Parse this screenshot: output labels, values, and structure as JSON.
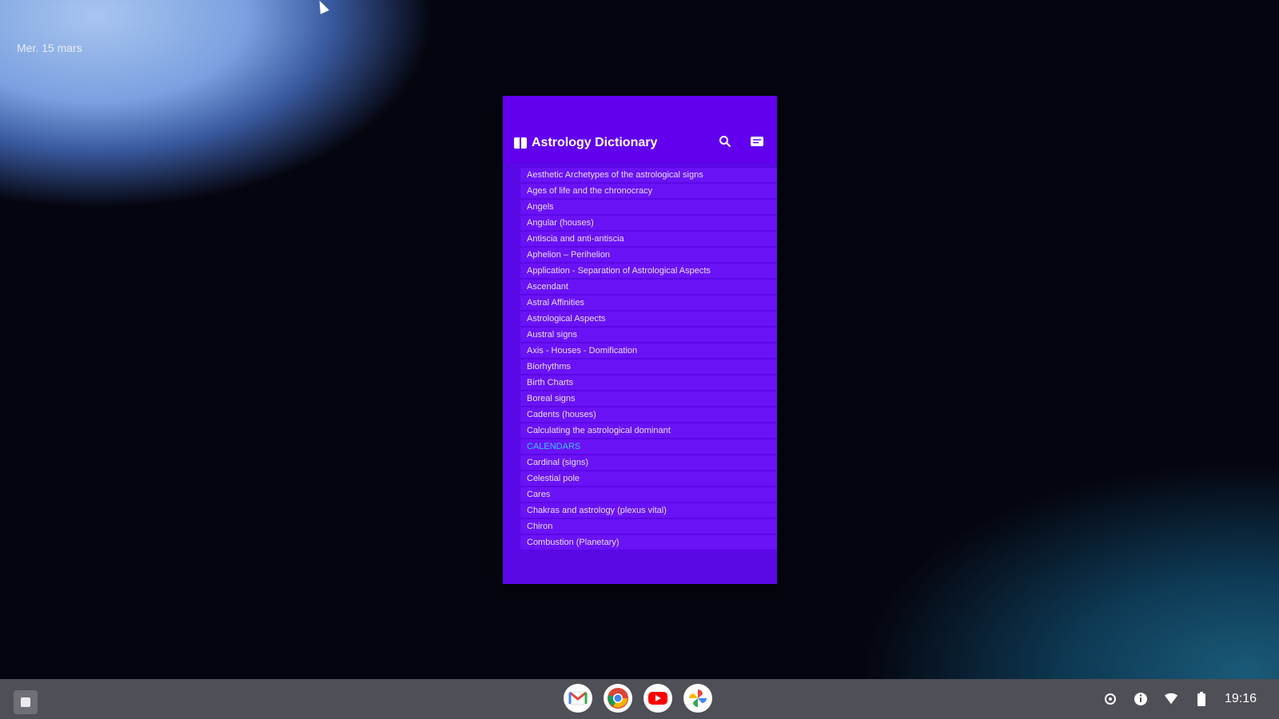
{
  "desktop": {
    "date_label": "Mer. 15 mars"
  },
  "app": {
    "title": "Astrology Dictionary",
    "icons": {
      "title_icon": "book-icon",
      "search": "search-icon",
      "message": "message-icon"
    },
    "colors": {
      "primary": "#6200ee",
      "list_bg": "#5a08e6",
      "item_bg": "#6a12f6",
      "special_item": "#38c8ff"
    },
    "list_items": [
      "Aesthetic Archetypes of the astrological signs",
      "Ages of life and the chronocracy",
      "Angels",
      "Angular (houses)",
      "Antiscia and anti-antiscia",
      "Aphelion – Perihelion",
      "Application - Separation of Astrological Aspects",
      "Ascendant",
      "Astral Affinities",
      "Astrological Aspects",
      "Austral signs",
      "Axis - Houses - Domification",
      "Biorhythms",
      "Birth Charts",
      "Boreal signs",
      "Cadents (houses)",
      "Calculating the astrological dominant",
      "CALENDARS",
      "Cardinal (signs)",
      "Celestial pole",
      "Cares",
      "Chakras and astrology (plexus vital)",
      "Chiron",
      "Combustion (Planetary)"
    ]
  },
  "shelf": {
    "launcher_icon": "launcher-icon",
    "apps": [
      "gmail-icon",
      "chrome-icon",
      "youtube-icon",
      "photos-icon"
    ],
    "tray_icons": [
      "settings-icon",
      "info-icon",
      "wifi-icon",
      "battery-icon"
    ],
    "clock": "19:16"
  }
}
